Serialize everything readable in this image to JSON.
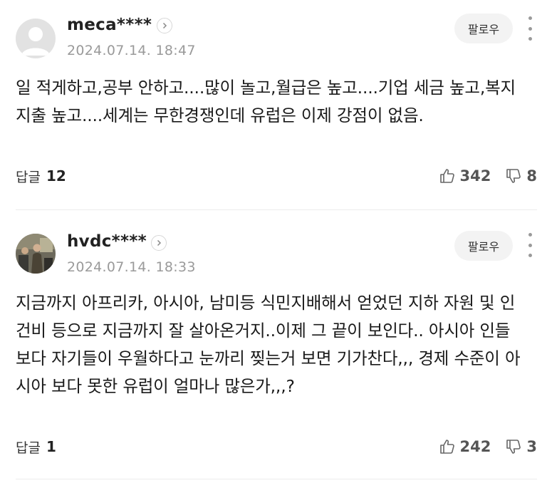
{
  "comments": [
    {
      "username": "meca****",
      "date": "2024.07.14. 18:47",
      "follow_label": "팔로우",
      "body": "일 적게하고,공부 안하고....많이 놀고,월급은 높고....기업 세금 높고,복지 지출 높고....세계는 무한경쟁인데 유럽은 이제 강점이 없음.",
      "reply_label": "답글",
      "reply_count": "12",
      "likes": "342",
      "dislikes": "8"
    },
    {
      "username": "hvdc****",
      "date": "2024.07.14. 18:33",
      "follow_label": "팔로우",
      "body": "지금까지 아프리카, 아시아, 남미등 식민지배해서 얻었던 지하 자원 및 인건비 등으로 지금까지 잘 살아온거지..이제 그 끝이 보인다.. 아시아 인들 보다 자기들이 우월하다고 눈까리 찢는거 보면 기가찬다,,, 경제 수준이 아시아 보다 못한 유럽이 얼마나 많은가,,,?",
      "reply_label": "답글",
      "reply_count": "1",
      "likes": "242",
      "dislikes": "3"
    }
  ],
  "icons": {
    "default_avatar": "person-silhouette-icon",
    "photo_avatar": "photo-avatar",
    "chevron": "chevron-right-icon",
    "more": "more-vertical-icon",
    "like": "thumbs-up-icon",
    "dislike": "thumbs-down-icon"
  }
}
